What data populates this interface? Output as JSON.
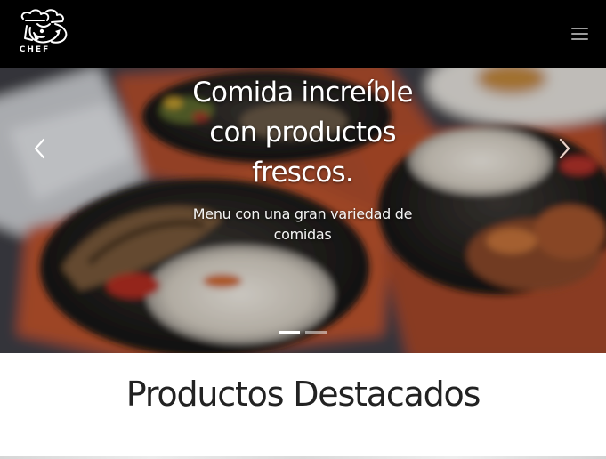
{
  "brand": {
    "logo_text": "CHEF",
    "logo_icon": "chef-hat-icon"
  },
  "navbar": {
    "menu_icon": "hamburger-menu-icon",
    "background": "#000000"
  },
  "carousel": {
    "title": "Comida increíble con productos frescos.",
    "subtitle": "Menu con una gran variedad de comidas",
    "prev_icon": "chevron-left-icon",
    "next_icon": "chevron-right-icon",
    "slide_count": 2,
    "active_slide": 1
  },
  "featured": {
    "title": "Productos Destacados"
  },
  "colors": {
    "navbar_bg": "#000000",
    "title_text": "#222222",
    "hero_text": "#ffffff"
  }
}
